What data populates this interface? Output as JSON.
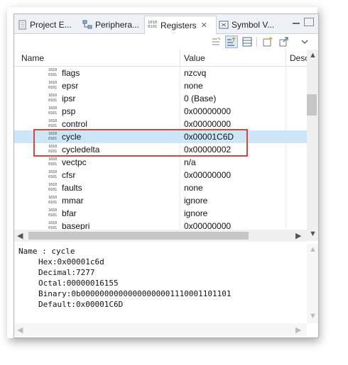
{
  "tabs": [
    {
      "label": "Project E...",
      "icon": "project-explorer-icon"
    },
    {
      "label": "Periphera...",
      "icon": "peripherals-icon"
    },
    {
      "label": "Registers",
      "icon": "registers-icon",
      "active": true
    },
    {
      "label": "Symbol V...",
      "icon": "symbol-viewer-icon"
    }
  ],
  "columns": {
    "name": "Name",
    "value": "Value",
    "desc": "Desc"
  },
  "registers": [
    {
      "name": "flags",
      "value": "nzcvq"
    },
    {
      "name": "epsr",
      "value": "none"
    },
    {
      "name": "ipsr",
      "value": "0  (Base)"
    },
    {
      "name": "psp",
      "value": "0x00000000"
    },
    {
      "name": "control",
      "value": "0x00000000"
    },
    {
      "name": "cycle",
      "value": "0x00001C6D",
      "selected": true
    },
    {
      "name": "cycledelta",
      "value": "0x00000002"
    },
    {
      "name": "vectpc",
      "value": "n/a"
    },
    {
      "name": "cfsr",
      "value": "0x00000000"
    },
    {
      "name": "faults",
      "value": "none"
    },
    {
      "name": "mmar",
      "value": "ignore"
    },
    {
      "name": "bfar",
      "value": "ignore"
    },
    {
      "name": "basepri",
      "value": "0x00000000"
    }
  ],
  "register_icon_text": "1010\n0101",
  "details": {
    "name": "Name : cycle",
    "hex": "Hex:0x00001c6d",
    "decimal": "Decimal:7277",
    "octal": "Octal:00000016155",
    "binary": "Binary:0b00000000000000000001110001101101",
    "default": "Default:0x00001C6D"
  },
  "colors": {
    "selection": "#cde6f7",
    "highlight_border": "#d9453b"
  }
}
